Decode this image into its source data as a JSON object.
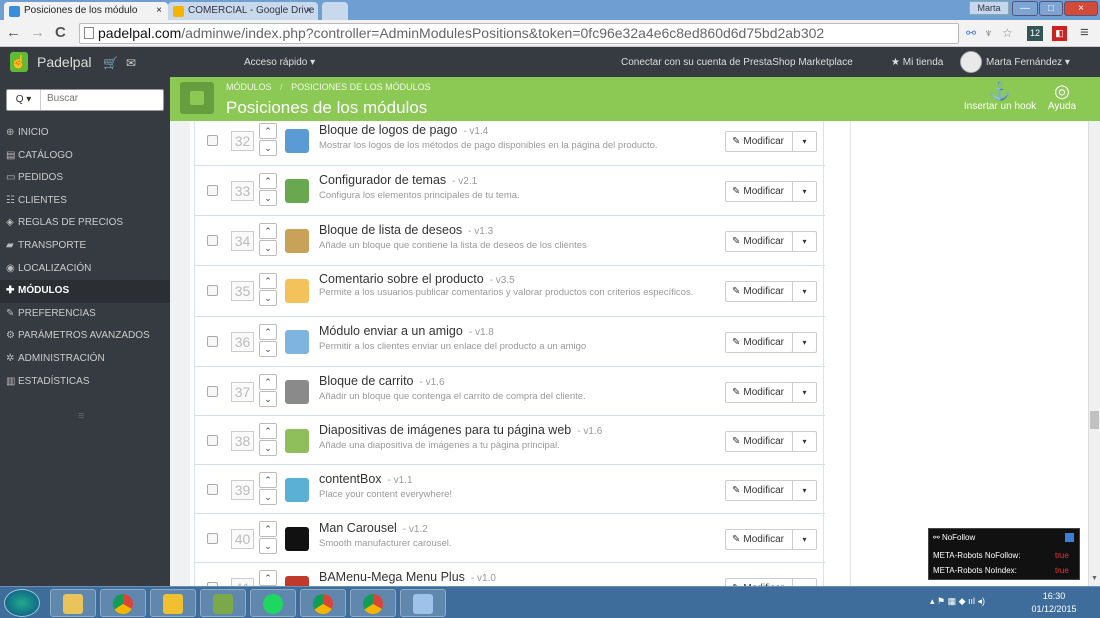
{
  "browser": {
    "tabs": [
      {
        "label": "Posiciones de los módulo",
        "close": "×"
      },
      {
        "label": "COMERCIAL - Google Drive",
        "close": "×"
      }
    ],
    "window_user": "Marta",
    "window_buttons": {
      "minimize": "—",
      "maximize": "□",
      "close": "×"
    },
    "url_host": "padelpal.com",
    "url_path": "/adminwe/index.php?controller=AdminModulesPositions&token=0fc96e32a4e6c8ed860d6d75bd2ab302",
    "ext_badge": "12",
    "nav": {
      "back": "←",
      "forward": "→",
      "reload": "C"
    }
  },
  "topbar": {
    "shop_name": "Padelpal",
    "quick_access": "Acceso rápido ▾",
    "connect": "Conectar con su cuenta de PrestaShop Marketplace",
    "my_store": "★ Mi tienda",
    "user": "Marta Fernández ▾",
    "hand_icon": "☝",
    "cart_icon": "🛒",
    "mail_icon": "✉"
  },
  "sidebar": {
    "search_button": "Q ▾",
    "search_placeholder": "Buscar",
    "items": [
      {
        "label": "INICIO",
        "icon": "⊕"
      },
      {
        "label": "CATÁLOGO",
        "icon": "▤"
      },
      {
        "label": "PEDIDOS",
        "icon": "▭"
      },
      {
        "label": "CLIENTES",
        "icon": "☷"
      },
      {
        "label": "REGLAS DE PRECIOS",
        "icon": "◈"
      },
      {
        "label": "TRANSPORTE",
        "icon": "▰"
      },
      {
        "label": "LOCALIZACIÓN",
        "icon": "◉"
      },
      {
        "label": "MÓDULOS",
        "icon": "✚"
      },
      {
        "label": "PREFERENCIAS",
        "icon": "✎"
      },
      {
        "label": "PARÁMETROS AVANZADOS",
        "icon": "⚙"
      },
      {
        "label": "ADMINISTRACIÓN",
        "icon": "✲"
      },
      {
        "label": "ESTADÍSTICAS",
        "icon": "▥"
      }
    ],
    "active_index": 7,
    "collapse_icon": "≡"
  },
  "header": {
    "breadcrumb_1": "MÓDULOS",
    "breadcrumb_sep": "/",
    "breadcrumb_2": "POSICIONES DE LOS MÓDULOS",
    "title": "Posiciones de los módulos",
    "hook_label": "Insertar un hook",
    "help_label": "Ayuda",
    "hook_icon": "⚓",
    "help_icon": "◎"
  },
  "modules": [
    {
      "pos": "32",
      "name": "Bloque de logos de pago",
      "version": "- v1.4",
      "desc": "Mostrar los logos de los métodos de pago disponibles en la página del producto.",
      "icon_color": "#5b9bd5"
    },
    {
      "pos": "33",
      "name": "Configurador de temas",
      "version": "- v2.1",
      "desc": "Configura los elementos principales de tu tema.",
      "icon_color": "#6aa84f"
    },
    {
      "pos": "34",
      "name": "Bloque de lista de deseos",
      "version": "- v1.3",
      "desc": "Añade un bloque que contiene la lista de deseos de los clientes",
      "icon_color": "#c9a25a"
    },
    {
      "pos": "35",
      "name": "Comentario sobre el producto",
      "version": "- v3.5",
      "desc": "Permite a los usuarios publicar comentarios y valorar productos con criterios específicos.",
      "icon_color": "#f3c25a"
    },
    {
      "pos": "36",
      "name": "Módulo enviar a un amigo",
      "version": "- v1.8",
      "desc": "Permitir a los clientes enviar un enlace del producto a un amigo",
      "icon_color": "#7fb3e0"
    },
    {
      "pos": "37",
      "name": "Bloque de carrito",
      "version": "- v1.6",
      "desc": "Añadir un bloque que contenga el carrito de compra del cliente.",
      "icon_color": "#8a8a8a"
    },
    {
      "pos": "38",
      "name": "Diapositivas de imágenes para tu página web",
      "version": "- v1.6",
      "desc": "Añade una diapositiva de imágenes a tu página principal.",
      "icon_color": "#8fbf5a"
    },
    {
      "pos": "39",
      "name": "contentBox",
      "version": "- v1.1",
      "desc": "Place your content everywhere!",
      "icon_color": "#5bb0d5"
    },
    {
      "pos": "40",
      "name": "Man Carousel",
      "version": "- v1.2",
      "desc": "Smooth manufacturer carousel.",
      "icon_color": "#111111"
    },
    {
      "pos": "41",
      "name": "BAMenu-Mega Menu Plus",
      "version": "- v1.0",
      "desc": "",
      "icon_color": "#c0392b"
    }
  ],
  "row_actions": {
    "modify": "Modificar",
    "pen": "✎",
    "caret": "▾",
    "up": "⌃",
    "down": "⌄"
  },
  "nofollow": {
    "title": "NoFollow",
    "rows": [
      {
        "label": "META-Robots NoFollow:",
        "value": "true"
      },
      {
        "label": "META-Robots NoIndex:",
        "value": "true"
      }
    ]
  },
  "taskbar": {
    "time": "16:30",
    "date": "01/12/2015"
  },
  "colors": {
    "accent": "#8bc954",
    "sidebar": "#363a41",
    "taskbar": "#3e6d9b"
  }
}
